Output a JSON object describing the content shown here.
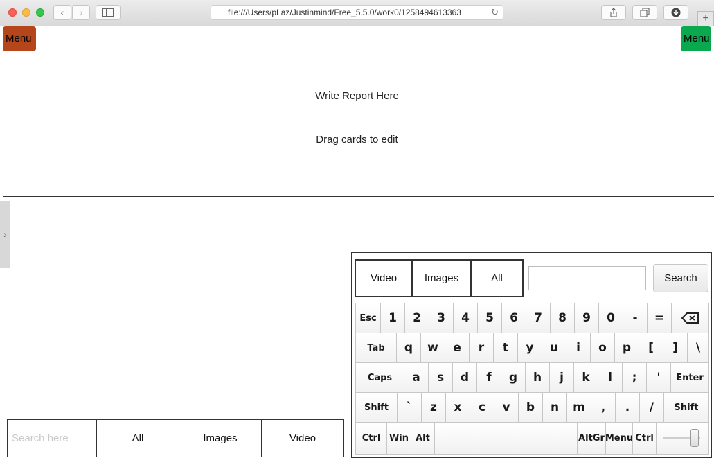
{
  "browser": {
    "url": "file:///Users/pLaz/Justinmind/Free_5.5.0/work0/1258494613363"
  },
  "header": {
    "menu_left_label": "Menu",
    "menu_right_label": "Menu",
    "menu_left_color": "#b5451b",
    "menu_right_color": "#0aa84f"
  },
  "report": {
    "title": "Write Report Here",
    "subtitle": "Drag cards to edit"
  },
  "bottom_bar": {
    "search_placeholder": "Search here",
    "tabs": [
      "All",
      "Images",
      "Video"
    ]
  },
  "keyboard_panel": {
    "tabs": [
      "Video",
      "Images",
      "All"
    ],
    "search_label": "Search",
    "rows": [
      [
        "Esc",
        "1",
        "2",
        "3",
        "4",
        "5",
        "6",
        "7",
        "8",
        "9",
        "0",
        "-",
        "=",
        "⌫"
      ],
      [
        "Tab",
        "q",
        "w",
        "e",
        "r",
        "t",
        "y",
        "u",
        "i",
        "o",
        "p",
        "[",
        "]",
        "\\"
      ],
      [
        "Caps",
        "a",
        "s",
        "d",
        "f",
        "g",
        "h",
        "j",
        "k",
        "l",
        ";",
        "'",
        "Enter"
      ],
      [
        "Shift",
        "`",
        "z",
        "x",
        "c",
        "v",
        "b",
        "n",
        "m",
        ",",
        ".",
        "/",
        "Shift"
      ],
      [
        "Ctrl",
        "Win",
        "Alt",
        "",
        "AltGr",
        "Menu",
        "Ctrl",
        ""
      ]
    ]
  }
}
